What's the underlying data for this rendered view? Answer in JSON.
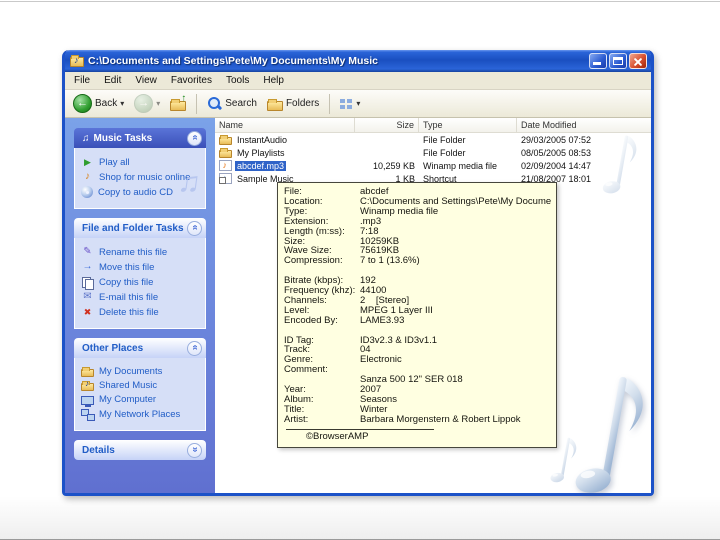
{
  "window": {
    "title": "C:\\Documents and Settings\\Pete\\My Documents\\My Music"
  },
  "menu": {
    "items": [
      {
        "label": "File"
      },
      {
        "label": "Edit"
      },
      {
        "label": "View"
      },
      {
        "label": "Favorites"
      },
      {
        "label": "Tools"
      },
      {
        "label": "Help"
      }
    ]
  },
  "toolbar": {
    "back_label": "Back",
    "search_label": "Search",
    "folders_label": "Folders"
  },
  "icons": {
    "window_icon": "music-folder-icon",
    "back": "back-arrow-icon",
    "forward": "forward-arrow-icon",
    "up": "folder-up-icon",
    "search": "magnifier-icon",
    "folders": "folder-icon",
    "views": "views-grid-icon"
  },
  "sidebar": {
    "music_tasks": {
      "title": "Music Tasks",
      "items": [
        {
          "label": "Play all",
          "icon": "play"
        },
        {
          "label": "Shop for music online",
          "icon": "shop"
        },
        {
          "label": "Copy to audio CD",
          "icon": "cd"
        }
      ]
    },
    "file_tasks": {
      "title": "File and Folder Tasks",
      "items": [
        {
          "label": "Rename this file",
          "icon": "rename"
        },
        {
          "label": "Move this file",
          "icon": "move"
        },
        {
          "label": "Copy this file",
          "icon": "copy"
        },
        {
          "label": "E-mail this file",
          "icon": "email"
        },
        {
          "label": "Delete this file",
          "icon": "delete"
        }
      ]
    },
    "other_places": {
      "title": "Other Places",
      "items": [
        {
          "label": "My Documents",
          "icon": "docs"
        },
        {
          "label": "Shared Music",
          "icon": "sharedmusic"
        },
        {
          "label": "My Computer",
          "icon": "computer"
        },
        {
          "label": "My Network Places",
          "icon": "network"
        }
      ]
    },
    "details": {
      "title": "Details"
    }
  },
  "filelist": {
    "columns": [
      {
        "label": "Name"
      },
      {
        "label": "Size"
      },
      {
        "label": "Type"
      },
      {
        "label": "Date Modified"
      }
    ],
    "rows": [
      {
        "name": "InstantAudio",
        "size": "",
        "type": "File Folder",
        "modified": "29/03/2005 07:52",
        "icon": "folder",
        "selected": false
      },
      {
        "name": "My Playlists",
        "size": "",
        "type": "File Folder",
        "modified": "08/05/2005 08:53",
        "icon": "folder",
        "selected": false
      },
      {
        "name": "abcdef.mp3",
        "size": "10,259 KB",
        "type": "Winamp media file",
        "modified": "02/09/2004 14:47",
        "icon": "music",
        "selected": true
      },
      {
        "name": "Sample Music",
        "size": "1 KB",
        "type": "Shortcut",
        "modified": "21/08/2007 18:01",
        "icon": "shortcut",
        "selected": false
      }
    ]
  },
  "tooltip": {
    "lines": [
      {
        "label": "File:",
        "value": "abcdef"
      },
      {
        "label": "Location:",
        "value": "C:\\Documents and Settings\\Pete\\My Documents\\My Music\\"
      },
      {
        "label": "Type:",
        "value": "Winamp media file"
      },
      {
        "label": "Extension:",
        "value": ".mp3"
      },
      {
        "label": "Length (m:ss):",
        "value": "7:18"
      },
      {
        "label": "Size:",
        "value": "10259KB"
      },
      {
        "label": "Wave Size:",
        "value": "75619KB"
      },
      {
        "label": "Compression:",
        "value": "7 to 1 (13.6%)"
      },
      {
        "label": "",
        "value": ""
      },
      {
        "label": "Bitrate (kbps):",
        "value": "192"
      },
      {
        "label": "Frequency (khz):",
        "value": "44100"
      },
      {
        "label": "Channels:",
        "value": "2    [Stereo]"
      },
      {
        "label": "Level:",
        "value": "MPEG 1 Layer III"
      },
      {
        "label": "Encoded By:",
        "value": "LAME3.93"
      },
      {
        "label": "",
        "value": ""
      },
      {
        "label": "ID Tag:",
        "value": "ID3v2.3 & ID3v1.1"
      },
      {
        "label": "Track:",
        "value": "04"
      },
      {
        "label": "Genre:",
        "value": "Electronic"
      },
      {
        "label": "Comment:",
        "value": ""
      },
      {
        "label": "",
        "value": "Sanza 500 12\" SER 018"
      },
      {
        "label": "Year:",
        "value": "2007"
      },
      {
        "label": "Album:",
        "value": "Seasons"
      },
      {
        "label": "Title:",
        "value": "Winter"
      },
      {
        "label": "Artist:",
        "value": "Barbara Morgenstern & Robert Lippok"
      }
    ],
    "footer": "©BrowserAMP"
  },
  "decor": {
    "note_glyph": "♫"
  },
  "colors": {
    "titlebar_blue": "#1a4fc0",
    "selection_blue": "#2f63c8",
    "taskpane_blue": "#6b85dc",
    "link_blue": "#215dc6",
    "tooltip_yellow": "#ffffe1"
  }
}
